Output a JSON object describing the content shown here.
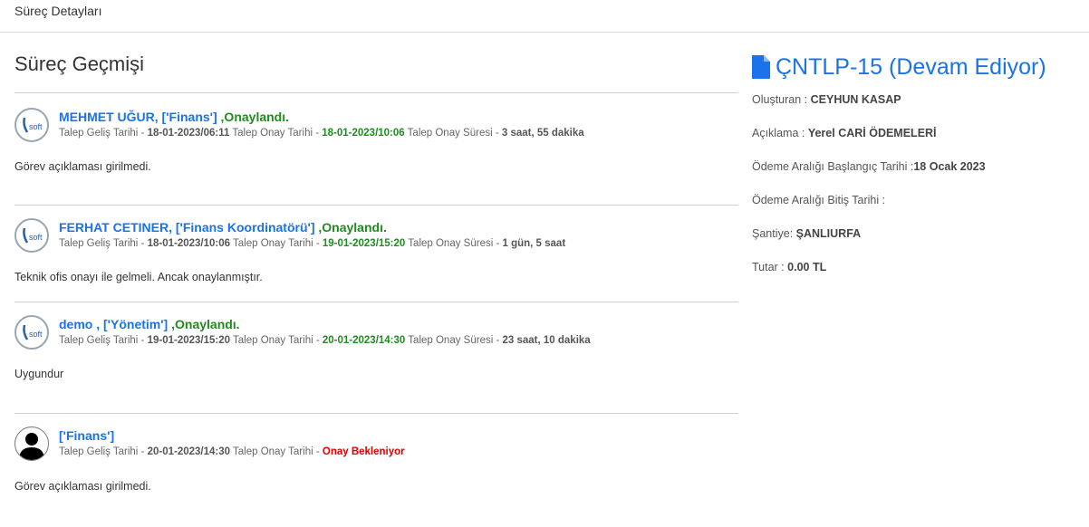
{
  "topbar": {
    "title": "Süreç Detayları"
  },
  "history": {
    "title": "Süreç Geçmişi",
    "entries": [
      {
        "avatar": "logo-soft",
        "name": "MEHMET UĞUR, ['Finans']",
        "status": ",Onaylandı.",
        "arrival_label": "Talep Geliş Tarihi - ",
        "arrival": "18-01-2023/06:11",
        "approval_label": " Talep Onay Tarihi - ",
        "approval": "18-01-2023/10:06",
        "duration_label": " Talep Onay Süresi - ",
        "duration": "3 saat, 55 dakika",
        "description": "Görev açıklaması girilmedi."
      },
      {
        "avatar": "logo-soft",
        "name": "FERHAT CETINER, ['Finans Koordinatörü']",
        "status": ",Onaylandı.",
        "arrival_label": "Talep Geliş Tarihi - ",
        "arrival": "18-01-2023/10:06",
        "approval_label": " Talep Onay Tarihi - ",
        "approval": "19-01-2023/15:20",
        "duration_label": " Talep Onay Süresi - ",
        "duration": "1 gün, 5 saat",
        "description": "Teknik ofis onayı ile gelmeli. Ancak onaylanmıştır."
      },
      {
        "avatar": "logo-soft",
        "name": "demo , ['Yönetim']",
        "status": ",Onaylandı.",
        "arrival_label": "Talep Geliş Tarihi - ",
        "arrival": "19-01-2023/15:20",
        "approval_label": " Talep Onay Tarihi - ",
        "approval": "20-01-2023/14:30",
        "duration_label": " Talep Onay Süresi - ",
        "duration": "23 saat, 10 dakika",
        "description": "Uygundur"
      },
      {
        "avatar": "person",
        "name": "['Finans']",
        "status": "",
        "arrival_label": "Talep Geliş Tarihi - ",
        "arrival": "20-01-2023/14:30",
        "approval_label": " Talep Onay Tarihi - ",
        "approval": "Onay Bekleniyor",
        "description": "Görev açıklaması girilmedi."
      }
    ]
  },
  "document": {
    "icon": "file-icon",
    "title": "ÇNTLP-15 (Devam Ediyor)",
    "fields": [
      {
        "label": "Oluşturan : ",
        "value": "CEYHUN KASAP"
      },
      {
        "label": "Açıklama : ",
        "value": "Yerel CARİ ÖDEMELERİ"
      },
      {
        "label": "Ödeme Aralığı Başlangıç Tarihi :",
        "value": "18 Ocak 2023"
      },
      {
        "label": "Ödeme Aralığı Bitiş Tarihi :",
        "value": ""
      },
      {
        "label": "Şantiye: ",
        "value": "ŞANLIURFA"
      },
      {
        "label": "Tutar : ",
        "value": "0.00 TL"
      }
    ]
  },
  "colors": {
    "link": "#1a73e8",
    "approved": "#1e8c1e",
    "pending": "#e00000"
  }
}
